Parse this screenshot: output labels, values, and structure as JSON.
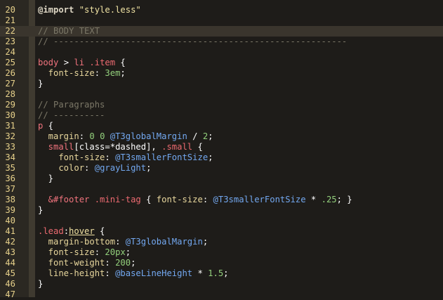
{
  "editor": {
    "lines": [
      {
        "num": "20",
        "tokens": [
          {
            "t": "@import",
            "c": "at"
          },
          {
            "t": " \"style.less\"",
            "c": "str"
          }
        ]
      },
      {
        "num": "21",
        "tokens": []
      },
      {
        "num": "22",
        "current": true,
        "tokens": [
          {
            "t": "// BODY TEXT",
            "c": "comment"
          }
        ]
      },
      {
        "num": "23",
        "tokens": [
          {
            "t": "// ---------------------------------------------------------",
            "c": "comment"
          }
        ]
      },
      {
        "num": "24",
        "tokens": []
      },
      {
        "num": "25",
        "tokens": [
          {
            "t": "body",
            "c": "tag"
          },
          {
            "t": " > ",
            "c": "punc"
          },
          {
            "t": "li",
            "c": "tag"
          },
          {
            "t": " ",
            "c": "plain"
          },
          {
            "t": ".item",
            "c": "cls"
          },
          {
            "t": " {",
            "c": "punc"
          }
        ]
      },
      {
        "num": "26",
        "tokens": [
          {
            "t": "  font-size",
            "c": "prop"
          },
          {
            "t": ": ",
            "c": "punc"
          },
          {
            "t": "3em",
            "c": "num"
          },
          {
            "t": ";",
            "c": "punc"
          }
        ]
      },
      {
        "num": "27",
        "tokens": [
          {
            "t": "}",
            "c": "punc"
          }
        ]
      },
      {
        "num": "28",
        "tokens": []
      },
      {
        "num": "29",
        "tokens": [
          {
            "t": "// Paragraphs",
            "c": "comment"
          }
        ]
      },
      {
        "num": "30",
        "tokens": [
          {
            "t": "// ----------",
            "c": "comment"
          }
        ]
      },
      {
        "num": "31",
        "tokens": [
          {
            "t": "p",
            "c": "tag"
          },
          {
            "t": " {",
            "c": "punc"
          }
        ]
      },
      {
        "num": "32",
        "tokens": [
          {
            "t": "  margin",
            "c": "prop"
          },
          {
            "t": ": ",
            "c": "punc"
          },
          {
            "t": "0 0",
            "c": "num"
          },
          {
            "t": " ",
            "c": "plain"
          },
          {
            "t": "@T3globalMargin",
            "c": "var"
          },
          {
            "t": " / ",
            "c": "punc"
          },
          {
            "t": "2",
            "c": "num"
          },
          {
            "t": ";",
            "c": "punc"
          }
        ]
      },
      {
        "num": "33",
        "tokens": [
          {
            "t": "  small",
            "c": "tag"
          },
          {
            "t": "[class=*dashed], ",
            "c": "punc"
          },
          {
            "t": ".small",
            "c": "cls"
          },
          {
            "t": " {",
            "c": "punc"
          }
        ]
      },
      {
        "num": "34",
        "tokens": [
          {
            "t": "    font-size",
            "c": "prop"
          },
          {
            "t": ": ",
            "c": "punc"
          },
          {
            "t": "@T3smallerFontSize",
            "c": "var"
          },
          {
            "t": ";",
            "c": "punc"
          }
        ]
      },
      {
        "num": "35",
        "tokens": [
          {
            "t": "    color",
            "c": "prop"
          },
          {
            "t": ": ",
            "c": "punc"
          },
          {
            "t": "@grayLight",
            "c": "var"
          },
          {
            "t": ";",
            "c": "punc"
          }
        ]
      },
      {
        "num": "36",
        "tokens": [
          {
            "t": "  }",
            "c": "punc"
          }
        ]
      },
      {
        "num": "37",
        "tokens": []
      },
      {
        "num": "38",
        "tokens": [
          {
            "t": "  &#footer",
            "c": "tag"
          },
          {
            "t": " ",
            "c": "plain"
          },
          {
            "t": ".mini-tag",
            "c": "cls"
          },
          {
            "t": " { ",
            "c": "punc"
          },
          {
            "t": "font-size",
            "c": "prop"
          },
          {
            "t": ": ",
            "c": "punc"
          },
          {
            "t": "@T3smallerFontSize",
            "c": "var"
          },
          {
            "t": " * ",
            "c": "punc"
          },
          {
            "t": ".25",
            "c": "num"
          },
          {
            "t": "; }",
            "c": "punc"
          }
        ]
      },
      {
        "num": "39",
        "tokens": [
          {
            "t": "}",
            "c": "punc"
          }
        ]
      },
      {
        "num": "40",
        "tokens": []
      },
      {
        "num": "41",
        "tokens": [
          {
            "t": ".lead",
            "c": "cls"
          },
          {
            "t": ":",
            "c": "punc"
          },
          {
            "t": "hover",
            "c": "under"
          },
          {
            "t": " {",
            "c": "punc"
          }
        ]
      },
      {
        "num": "42",
        "tokens": [
          {
            "t": "  margin-bottom",
            "c": "prop"
          },
          {
            "t": ": ",
            "c": "punc"
          },
          {
            "t": "@T3globalMargin",
            "c": "var"
          },
          {
            "t": ";",
            "c": "punc"
          }
        ]
      },
      {
        "num": "43",
        "tokens": [
          {
            "t": "  font-size",
            "c": "prop"
          },
          {
            "t": ": ",
            "c": "punc"
          },
          {
            "t": "20px",
            "c": "num"
          },
          {
            "t": ";",
            "c": "punc"
          }
        ]
      },
      {
        "num": "44",
        "tokens": [
          {
            "t": "  font-weight",
            "c": "prop"
          },
          {
            "t": ": ",
            "c": "punc"
          },
          {
            "t": "200",
            "c": "num"
          },
          {
            "t": ";",
            "c": "punc"
          }
        ]
      },
      {
        "num": "45",
        "tokens": [
          {
            "t": "  line-height",
            "c": "prop"
          },
          {
            "t": ": ",
            "c": "punc"
          },
          {
            "t": "@baseLineHeight",
            "c": "var"
          },
          {
            "t": " * ",
            "c": "punc"
          },
          {
            "t": "1.5",
            "c": "num"
          },
          {
            "t": ";",
            "c": "punc"
          }
        ]
      },
      {
        "num": "46",
        "tokens": [
          {
            "t": "}",
            "c": "punc"
          }
        ]
      },
      {
        "num": "47",
        "tokens": []
      }
    ]
  }
}
